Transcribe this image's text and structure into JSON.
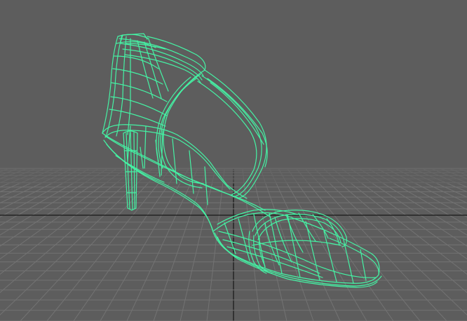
{
  "viewport": {
    "view": "perspective",
    "background_color": "#5d5d5d",
    "grid": {
      "visible": true,
      "line_color": "#737373",
      "axis_color": "#202020"
    },
    "selection": {
      "object": "high-heel-sandal",
      "display_mode": "wireframe",
      "highlighted": true,
      "wire_color": "#45f2a4"
    }
  }
}
